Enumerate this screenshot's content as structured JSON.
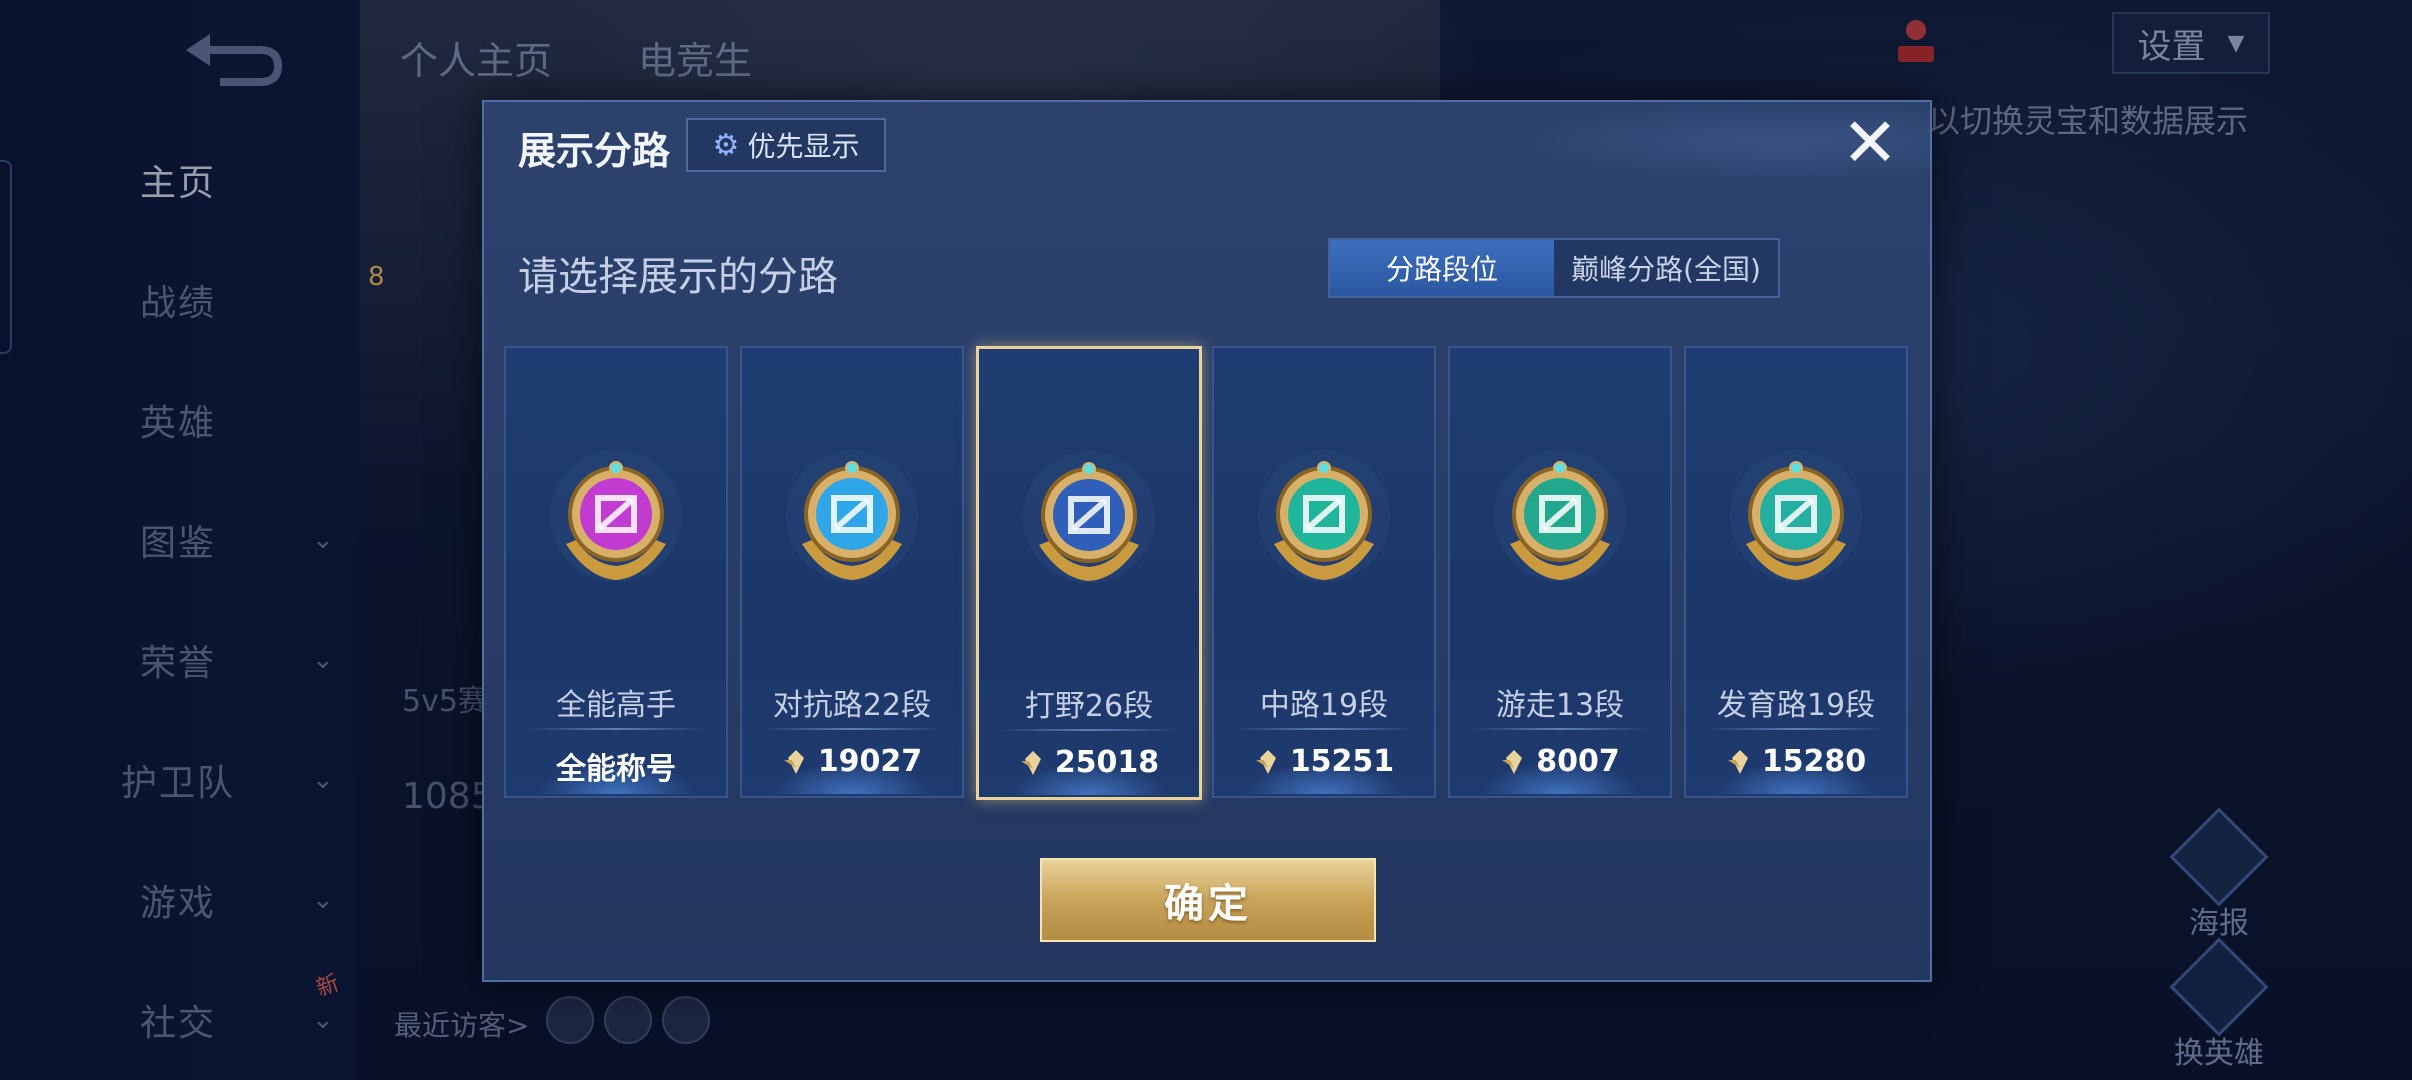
{
  "sidebar": {
    "items": [
      {
        "label": "主页",
        "active": true,
        "chevron": false
      },
      {
        "label": "战绩",
        "active": false,
        "chevron": false
      },
      {
        "label": "英雄",
        "active": false,
        "chevron": false
      },
      {
        "label": "图鉴",
        "active": false,
        "chevron": true
      },
      {
        "label": "荣誉",
        "active": false,
        "chevron": true
      },
      {
        "label": "护卫队",
        "active": false,
        "chevron": true
      },
      {
        "label": "游戏",
        "active": false,
        "chevron": true
      },
      {
        "label": "社交",
        "active": false,
        "chevron": true
      }
    ],
    "new_badge": "新"
  },
  "background": {
    "tabs": [
      "个人主页",
      "电竞生"
    ],
    "settings_label": "设置",
    "hint": "以切换灵宝和数据展示",
    "recent_visitors": "最近访客>",
    "mode_text": "5v5赛",
    "stat_number": "1085",
    "poster_label": "海报",
    "swap_hero_label": "换英雄",
    "level": "8"
  },
  "modal": {
    "title": "展示分路",
    "priority_label": "优先显示",
    "close_symbol": "✕",
    "subtitle": "请选择展示的分路",
    "segments": [
      {
        "label": "分路段位",
        "active": true
      },
      {
        "label": "巅峰分路(全国)",
        "active": false
      }
    ],
    "lanes": [
      {
        "name": "全能高手",
        "value": "全能称号",
        "has_icon": false,
        "selected": false,
        "color": "#c23bd0",
        "icon": "all-round-emblem"
      },
      {
        "name": "对抗路22段",
        "value": "19027",
        "has_icon": true,
        "selected": false,
        "color": "#2fa6e8",
        "icon": "clash-lane-emblem"
      },
      {
        "name": "打野26段",
        "value": "25018",
        "has_icon": true,
        "selected": true,
        "color": "#2f5fb8",
        "icon": "jungle-emblem"
      },
      {
        "name": "中路19段",
        "value": "15251",
        "has_icon": true,
        "selected": false,
        "color": "#1fb59a",
        "icon": "mid-lane-emblem"
      },
      {
        "name": "游走13段",
        "value": "8007",
        "has_icon": true,
        "selected": false,
        "color": "#22a88c",
        "icon": "roam-emblem"
      },
      {
        "name": "发育路19段",
        "value": "15280",
        "has_icon": true,
        "selected": false,
        "color": "#24b0a0",
        "icon": "farm-lane-emblem"
      }
    ],
    "confirm_label": "确定"
  },
  "colors": {
    "accent_gold": "#e9d39a",
    "panel": "#283d68",
    "segment_active": "#3d6fbf"
  }
}
